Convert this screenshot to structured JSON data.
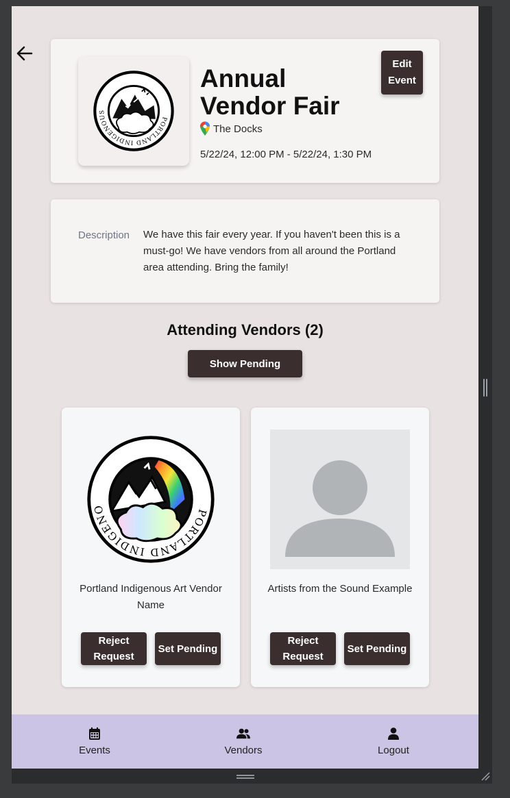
{
  "event": {
    "title": "Annual Vendor Fair",
    "location": "The Docks",
    "dates": "5/22/24, 12:00 PM - 5/22/24, 1:30 PM",
    "edit_label": "Edit Event",
    "logo_text": "PORTLAND INDIGENOUS MARKETPLACE"
  },
  "description": {
    "label": "Description",
    "text": "We have this fair every year. If you haven't been this is a must-go! We have vendors from all around the Portland area attending. Bring the family!"
  },
  "vendors_section": {
    "heading": "Attending Vendors (2)",
    "show_pending_label": "Show Pending"
  },
  "vendors": [
    {
      "name": "Portland Indigenous Art Vendor Name",
      "image": "portland-indigenous-marketplace-logo",
      "reject_label": "Reject Request",
      "pending_label": "Set Pending"
    },
    {
      "name": "Artists from the Sound Example",
      "image": "default-avatar",
      "reject_label": "Reject Request",
      "pending_label": "Set Pending"
    }
  ],
  "nav": {
    "items": [
      {
        "label": "Events",
        "icon": "calendar-icon"
      },
      {
        "label": "Vendors",
        "icon": "users-icon"
      },
      {
        "label": "Logout",
        "icon": "user-icon"
      }
    ]
  },
  "colors": {
    "background": "#e8e2e2",
    "card": "#f6f3f3",
    "button": "#3b2e2e",
    "nav": "#cbc4e4"
  }
}
